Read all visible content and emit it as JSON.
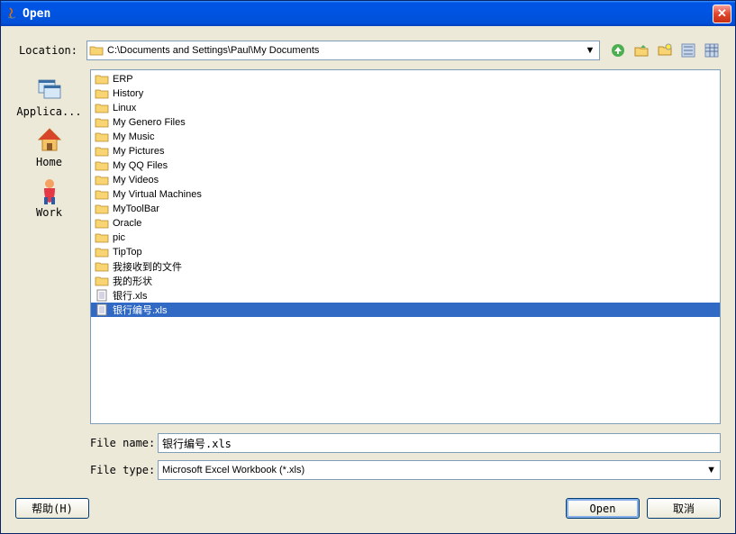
{
  "title": "Open",
  "location_label": "Location:",
  "location_path": "C:\\Documents and Settings\\Paul\\My Documents",
  "places": [
    {
      "label": "Applica..."
    },
    {
      "label": "Home"
    },
    {
      "label": "Work"
    }
  ],
  "files": [
    {
      "name": "ERP",
      "type": "folder"
    },
    {
      "name": "History",
      "type": "folder"
    },
    {
      "name": "Linux",
      "type": "folder"
    },
    {
      "name": "My Genero Files",
      "type": "folder"
    },
    {
      "name": "My Music",
      "type": "folder"
    },
    {
      "name": "My Pictures",
      "type": "folder"
    },
    {
      "name": "My QQ Files",
      "type": "folder"
    },
    {
      "name": "My Videos",
      "type": "folder"
    },
    {
      "name": "My Virtual Machines",
      "type": "folder"
    },
    {
      "name": "MyToolBar",
      "type": "folder"
    },
    {
      "name": "Oracle",
      "type": "folder"
    },
    {
      "name": "pic",
      "type": "folder"
    },
    {
      "name": "TipTop",
      "type": "folder"
    },
    {
      "name": "我接收到的文件",
      "type": "folder"
    },
    {
      "name": "我的形状",
      "type": "folder"
    },
    {
      "name": "银行.xls",
      "type": "file"
    },
    {
      "name": "银行编号.xls",
      "type": "file",
      "selected": true
    }
  ],
  "filename_label": "File name:",
  "filename_value": "银行编号.xls",
  "filetype_label": "File type:",
  "filetype_value": "Microsoft Excel Workbook (*.xls)",
  "help_btn": "帮助(H)",
  "open_btn": "Open",
  "cancel_btn": "取消"
}
